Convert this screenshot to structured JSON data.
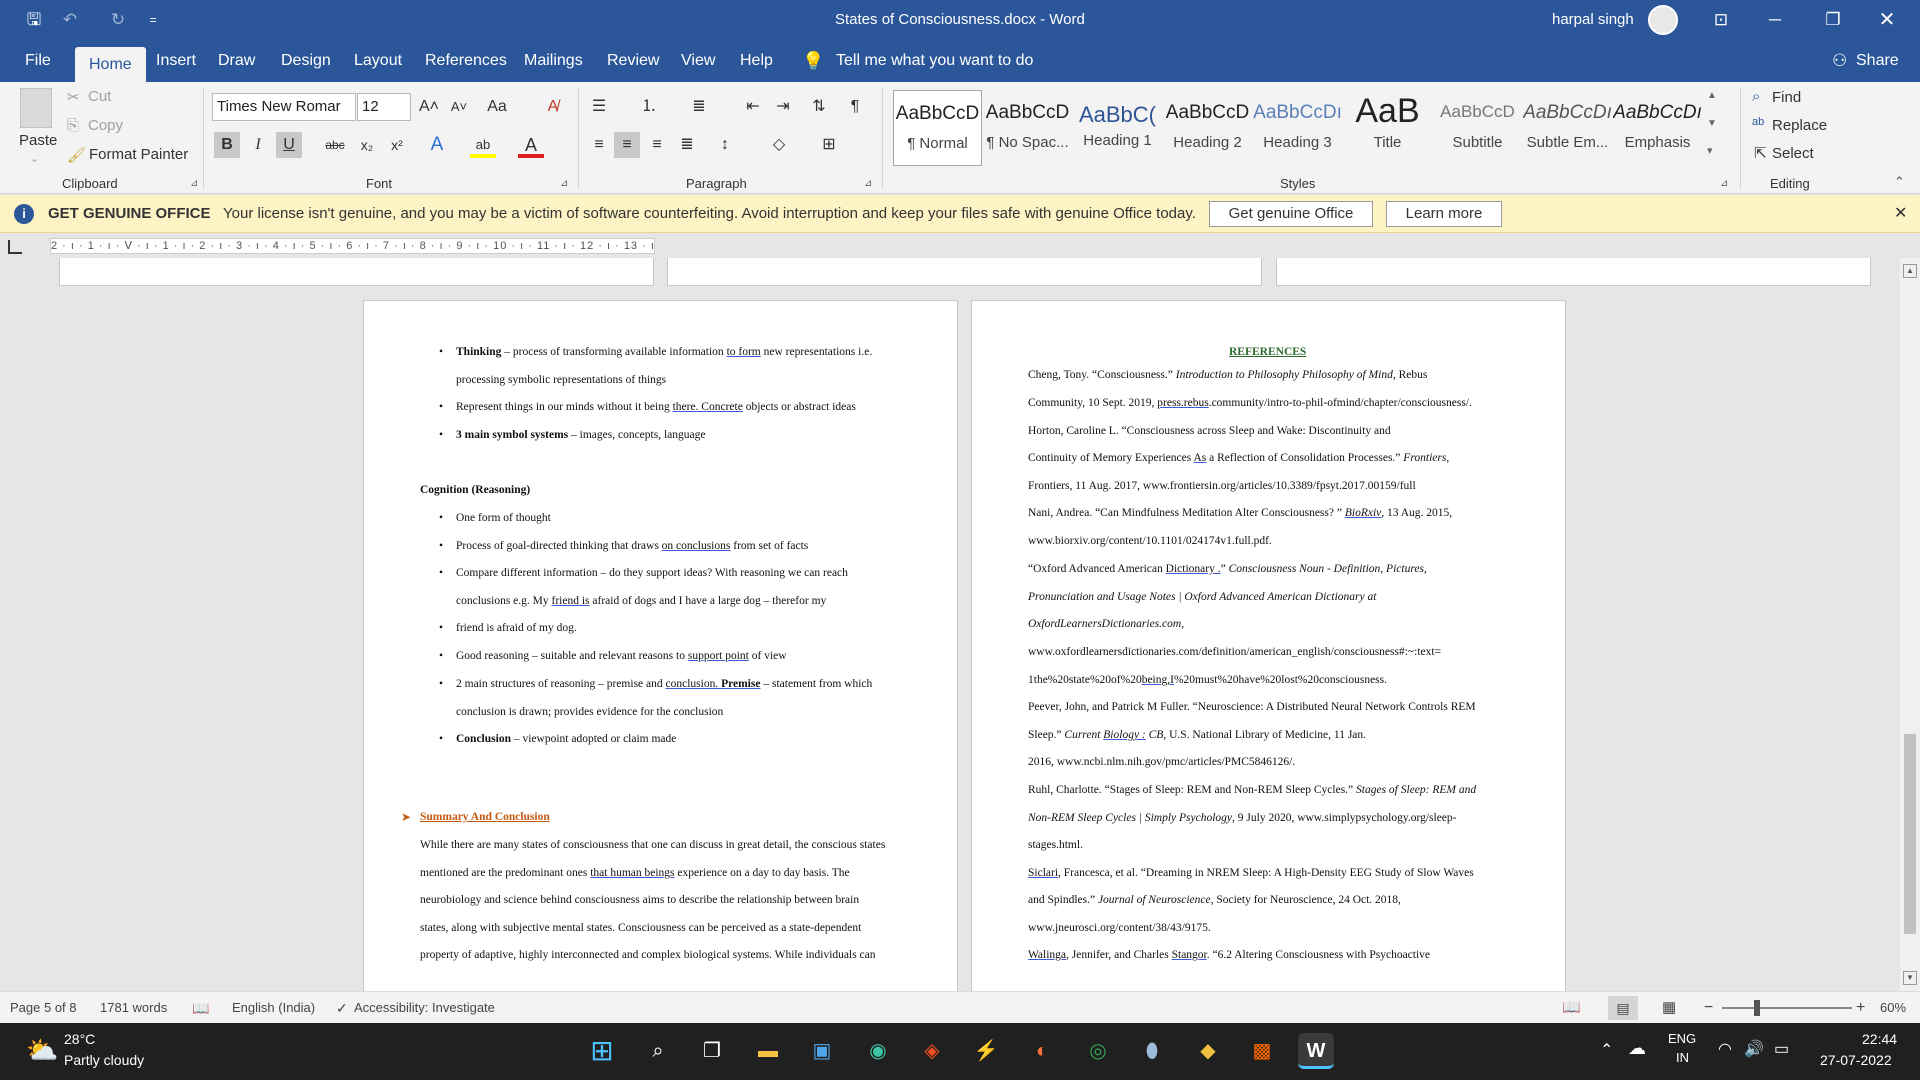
{
  "title_bar": {
    "title": "States of Consciousness.docx  -  Word",
    "user": "harpal singh",
    "qa_more": "="
  },
  "menu": {
    "file": "File",
    "tabs": [
      "Home",
      "Insert",
      "Draw",
      "Design",
      "Layout",
      "References",
      "Mailings",
      "Review",
      "View",
      "Help"
    ],
    "tell_me": "Tell me what you want to do",
    "share": "Share"
  },
  "clipboard": {
    "paste": "Paste",
    "cut": "Cut",
    "copy": "Copy",
    "format_painter": "Format Painter",
    "group": "Clipboard"
  },
  "font": {
    "name": "Times New Romar",
    "size": "12",
    "bold": "B",
    "italic": "I",
    "underline": "U",
    "strike": "abc",
    "sub": "x₂",
    "sup": "x²",
    "group": "Font"
  },
  "paragraph": {
    "group": "Paragraph"
  },
  "styles": {
    "items": [
      {
        "preview": "AaBbCcD",
        "name": "¶ Normal"
      },
      {
        "preview": "AaBbCcD",
        "name": "¶ No Spac..."
      },
      {
        "preview": "AaBbC(",
        "name": "Heading 1"
      },
      {
        "preview": "AaBbCcD",
        "name": "Heading 2"
      },
      {
        "preview": "AaBbCcDı",
        "name": "Heading 3"
      },
      {
        "preview": "AaB",
        "name": "Title"
      },
      {
        "preview": "AaBbCcD",
        "name": "Subtitle"
      },
      {
        "preview": "AaBbCcDı",
        "name": "Subtle Em..."
      },
      {
        "preview": "AaBbCcDı",
        "name": "Emphasis"
      }
    ],
    "group": "Styles"
  },
  "editing": {
    "find": "Find",
    "replace": "Replace",
    "select": "Select",
    "group": "Editing"
  },
  "license": {
    "title": "GET GENUINE OFFICE",
    "message": "Your license isn't genuine, and you may be a victim of software counterfeiting. Avoid interruption and keep your files safe with genuine Office today.",
    "get_button": "Get genuine Office",
    "learn_button": "Learn more"
  },
  "ruler": {
    "scale": "2 · ı · 1 · ı · ᐯ · ı · 1 · ı · 2 · ı · 3 · ı · 4 · ı · 5 · ı · 6 · ı · 7 · ı · 8 · ı · 9 · ı · 10 · ı · 11 · ı · 12 · ı · 13 · ı · 14 · ı · 15 · ı · 16 · ı · ı · 18 · ı"
  },
  "left_page": {
    "b1_bold": "Thinking",
    "b1_a": " – process of transforming available information ",
    "b1_u": "to  form",
    "b1_b": " new representations i.e.",
    "b1_cont": "processing symbolic  representations of things",
    "b2_a": "Represent things in our minds without it being ",
    "b2_u": "there. Concrete",
    "b2_b": " objects or abstract ideas",
    "b3_bold": "3 main symbol systems",
    "b3_a": " – images, concepts, language",
    "heading": "Cognition (Reasoning)",
    "c1": "One form of thought",
    "c2_a": "Process of goal-directed thinking that draws ",
    "c2_u": "on  conclusions",
    "c2_b": " from set of facts",
    "c3": "Compare  different  information  –  do  they  support  ideas?   With  reasoning  we  can  reach",
    "c3_cont_a": "conclusions e.g. My ",
    "c3_cont_u": "friend  is",
    "c3_cont_b": " afraid of dogs and I have a large dog – therefor my",
    "c4": "friend is afraid of my dog.",
    "c5_a": "Good reasoning – suitable and relevant reasons to ",
    "c5_u": "support  point",
    "c5_b": " of view",
    "c6_a": "2 main structures of reasoning – premise and ",
    "c6_u": "conclusion. ",
    "c6_bold": "Premise",
    "c6_b": " – statement from which",
    "c6_cont": "conclusion is drawn;  provides evidence for the conclusion",
    "c7_bold": "Conclusion",
    "c7_a": " – viewpoint adopted or claim made",
    "summary_heading": "Summary And Conclusion",
    "s1": "While there are many states of consciousness that one can discuss in great detail, the conscious states",
    "s2_a": "mentioned  are  the  predominant  ones  ",
    "s2_u": "that  human  beings",
    "s2_b": "  experience  on  a  day  to  day  basis.  The",
    "s3": "neurobiology  and  science  behind  consciousness  aims  to  describe  the  relationship  between  brain",
    "s4": "states,  along  with  subjective  mental  states.  Consciousness  can  be  perceived  as  a  state-dependent",
    "s5": "property  of  adaptive,  highly  interconnected  and  complex  biological  systems.  While  individuals  can"
  },
  "right_page": {
    "heading": "REFERENCES",
    "r1a": "Cheng, Tony. “Consciousness.” ",
    "r1i": "Introduction to Philosophy Philosophy of Mind",
    "r1b": ", Rebus",
    "r2a": "Community, 10 Sept. 2019, ",
    "r2u": "press.rebus",
    "r2b": ".community/intro-to-phil-ofmind/chapter/consciousness/.",
    "r3": "Horton, Caroline L. “Consciousness across Sleep and Wake: Discontinuity and",
    "r4a": "Continuity of Memory Experiences ",
    "r4u": "As",
    "r4b": " a Reflection of Consolidation Processes.” ",
    "r4i": "Frontiers",
    "r4c": ",",
    "r5": "Frontiers, 11 Aug. 2017, www.frontiersin.org/articles/10.3389/fpsyt.2017.00159/full",
    "r6a": "Nani, Andrea. “Can Mindfulness Meditation Alter Consciousness?  ” ",
    "r6i": "BioRxiv",
    "r6b": ", 13 Aug. 2015,",
    "r7": "www.biorxiv.org/content/10.1101/024174v1.full.pdf.",
    "r8a": "“Oxford Advanced American ",
    "r8u": "Dictionary  .",
    "r8b": "” ",
    "r8i": "Consciousness Noun - Definition, Pictures,",
    "r9": "Pronunciation and Usage Notes | Oxford Advanced American Dictionary at",
    "r10a": "OxfordLearnersDictionaries.com",
    "r10b": ",",
    "r11": "www.oxfordlearnersdictionaries.com/definition/american_english/consciousness#:~:text=",
    "r12a": "1the%20state%20of%20",
    "r12u": "being,I",
    "r12b": "%20must%20have%20lost%20consciousness.",
    "r13": "Peever, John, and Patrick M Fuller. “Neuroscience: A Distributed Neural Network Controls REM",
    "r14a": "Sleep.” ",
    "r14i": "Current ",
    "r14u": "Biology  :",
    "r14j": " CB",
    "r14b": ", U.S. National Library of Medicine, 11 Jan.",
    "r15": "2016, www.ncbi.nlm.nih.gov/pmc/articles/PMC5846126/.",
    "r16a": "Ruhl, Charlotte. “Stages of Sleep: REM and Non-REM Sleep Cycles.” ",
    "r16i": "Stages of Sleep: REM and",
    "r17i": "Non-REM Sleep Cycles | Simply Psychology",
    "r17b": ", 9 July 2020, www.simplypsychology.org/sleep-",
    "r18": "stages.html.",
    "r19u": "Siclari",
    "r19a": ", Francesca, et al. “Dreaming in NREM Sleep: A High-Density EEG Study of Slow Waves",
    "r20a": "and Spindles.” ",
    "r20i": "Journal of Neuroscience",
    "r20b": ", Society for Neuroscience, 24 Oct. 2018,",
    "r21": "www.jneurosci.org/content/38/43/9175.",
    "r22u1": "Walinga",
    "r22a": ", Jennifer, and Charles ",
    "r22u2": "Stangor",
    "r22b": ". “6.2 Altering Consciousness with Psychoactive"
  },
  "status": {
    "page": "Page 5 of 8",
    "words": "1781 words",
    "language": "English (India)",
    "accessibility": "Accessibility: Investigate",
    "zoom": "60%"
  },
  "taskbar": {
    "temp": "28°C",
    "weather": "Partly cloudy",
    "lang1": "ENG",
    "lang2": "IN",
    "time": "22:44",
    "date": "27-07-2022"
  },
  "colors": {
    "word_blue": "#2b579a",
    "license_bg": "#fdf3c4",
    "ref_heading": "#2e6b2e",
    "summary_heading": "#c55a11"
  }
}
